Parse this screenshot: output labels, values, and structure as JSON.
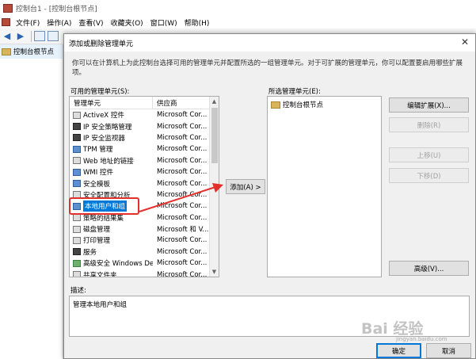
{
  "window": {
    "title": "控制台1 - [控制台根节点]"
  },
  "menu": [
    {
      "label": "文件(F)"
    },
    {
      "label": "操作(A)"
    },
    {
      "label": "查看(V)"
    },
    {
      "label": "收藏夹(O)"
    },
    {
      "label": "窗口(W)"
    },
    {
      "label": "帮助(H)"
    }
  ],
  "tree": {
    "root": "控制台根节点"
  },
  "dialog": {
    "title": "添加或删除管理单元",
    "description": "你可以在计算机上为此控制台选择可用的管理单元并配置所选的一组管理单元。对于可扩展的管理单元，你可以配置要启用哪些扩展项。",
    "available_label": "可用的管理单元(S):",
    "selected_label": "所选管理单元(E):",
    "columns": {
      "name": "管理单元",
      "vendor": "供应商"
    },
    "snapins": [
      {
        "name": "ActiveX 控件",
        "vendor": "Microsoft Cor...",
        "icon": "activex-icon"
      },
      {
        "name": "IP 安全策略管理",
        "vendor": "Microsoft Cor...",
        "icon": "ip-security-policy-icon"
      },
      {
        "name": "IP 安全监视器",
        "vendor": "Microsoft Cor...",
        "icon": "ip-security-monitor-icon"
      },
      {
        "name": "TPM 管理",
        "vendor": "Microsoft Cor...",
        "icon": "tpm-icon"
      },
      {
        "name": "Web 地址的链接",
        "vendor": "Microsoft Cor...",
        "icon": "web-link-icon"
      },
      {
        "name": "WMI 控件",
        "vendor": "Microsoft Cor...",
        "icon": "wmi-icon"
      },
      {
        "name": "安全模板",
        "vendor": "Microsoft Cor...",
        "icon": "security-template-icon"
      },
      {
        "name": "安全配置和分析",
        "vendor": "Microsoft Cor...",
        "icon": "security-config-icon"
      },
      {
        "name": "本地用户和组",
        "vendor": "Microsoft Cor...",
        "icon": "users-icon"
      },
      {
        "name": "策略的结果集",
        "vendor": "Microsoft Cor...",
        "icon": "policy-result-icon"
      },
      {
        "name": "磁盘管理",
        "vendor": "Microsoft 和 V...",
        "icon": "disk-icon"
      },
      {
        "name": "打印管理",
        "vendor": "Microsoft Cor...",
        "icon": "printer-icon"
      },
      {
        "name": "服务",
        "vendor": "Microsoft Cor...",
        "icon": "services-icon"
      },
      {
        "name": "高级安全 Windows De...",
        "vendor": "Microsoft Cor...",
        "icon": "firewall-icon"
      },
      {
        "name": "共享文件夹",
        "vendor": "Microsoft Cor...",
        "icon": "shared-folder-icon"
      }
    ],
    "selected_index": 8,
    "selected_snapins": [
      {
        "name": "控制台根节点"
      }
    ],
    "buttons": {
      "add": "添加(A) >",
      "edit_ext": "编辑扩展(X)...",
      "remove": "删除(R)",
      "move_up": "上移(U)",
      "move_down": "下移(D)",
      "advanced": "高级(V)...",
      "ok": "确定",
      "cancel": "取消"
    },
    "desc_label": "描述:",
    "desc_text": "管理本地用户和组"
  },
  "watermark": {
    "text": "Bai 经验",
    "sub": "jingyan.baidu.com"
  },
  "colors": {
    "selection": "#0078d7",
    "annotation": "#e4302a"
  }
}
